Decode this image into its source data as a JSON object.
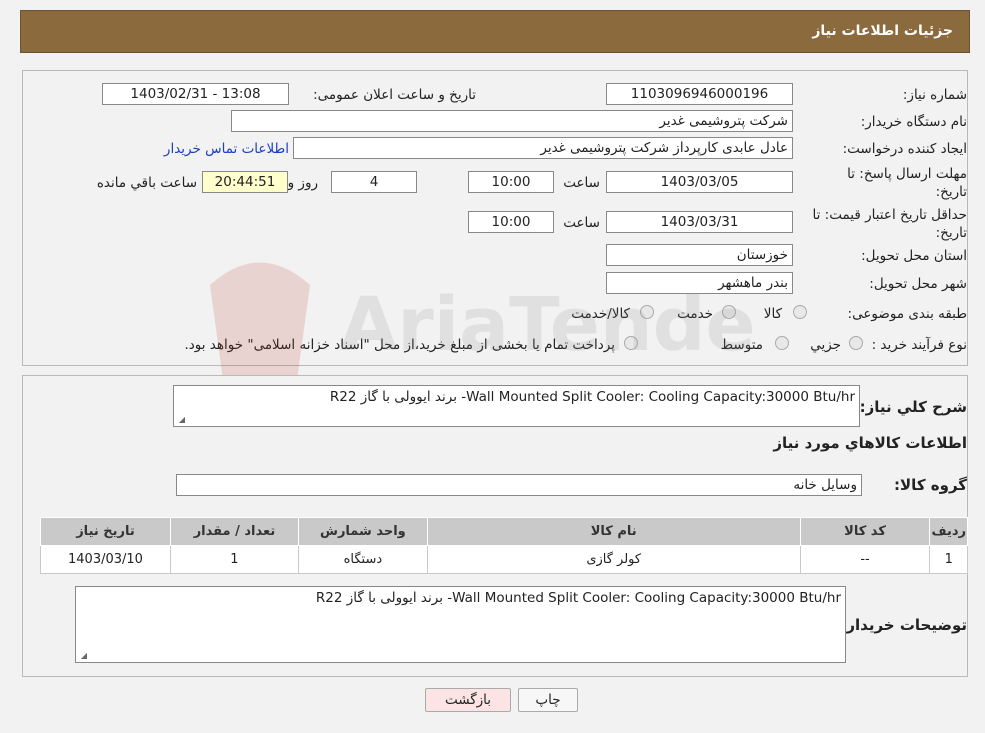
{
  "header": {
    "title": "جزئیات اطلاعات نیاز"
  },
  "form": {
    "need_number_label": "شماره نیاز:",
    "need_number": "1103096946000196",
    "announce_label": "تاریخ و ساعت اعلان عمومی:",
    "announce_value": "1403/02/31 - 13:08",
    "buyer_org_label": "نام دستگاه خریدار:",
    "buyer_org": "شرکت پتروشیمی غدیر",
    "creator_label": "ایجاد کننده درخواست:",
    "creator": "عادل عابدی کارپرداز شرکت پتروشیمی غدیر",
    "contact_link": "اطلاعات تماس خریدار",
    "deadline_label_1": "مهلت ارسال پاسخ: تا",
    "deadline_label_2": "تاریخ:",
    "deadline_date": "1403/03/05",
    "time_label": "ساعت",
    "deadline_time": "10:00",
    "days_value": "4",
    "days_label": "روز و",
    "remaining_time": "20:44:51",
    "remaining_label": "ساعت باقي مانده",
    "validity_label_1": "حداقل تاریخ اعتبار قیمت: تا",
    "validity_label_2": "تاریخ:",
    "validity_date": "1403/03/31",
    "validity_time": "10:00",
    "province_label": "استان محل تحویل:",
    "province": "خوزستان",
    "city_label": "شهر محل تحویل:",
    "city": "بندر ماهشهر",
    "category_label": "طبقه بندی موضوعی:",
    "category_options": [
      "کالا",
      "خدمت",
      "کالا/خدمت"
    ],
    "process_label": "نوع فرآیند خرید :",
    "process_options": [
      "جزيي",
      "متوسط"
    ],
    "process_note": "پرداخت تمام یا بخشی از مبلغ خرید،از محل \"اسناد خزانه اسلامی\" خواهد بود."
  },
  "details": {
    "desc_label": "شرح کلي نياز:",
    "desc_value": "Wall Mounted Split Cooler: Cooling Capacity:30000 Btu/hr- برند ایوولی با گاز R22",
    "goods_info_title": "اطلاعات کالاهاي مورد نياز",
    "goods_group_label": "گروه کالا:",
    "goods_group_value": "وسایل خانه",
    "table": {
      "headers": [
        "رديف",
        "کد کالا",
        "نام کالا",
        "واحد شمارش",
        "تعداد / مقدار",
        "تاریخ نیاز"
      ],
      "rows": [
        [
          "1",
          "--",
          "کولر گازی",
          "دستگاه",
          "1",
          "1403/03/10"
        ]
      ]
    },
    "buyer_notes_label": "توضیحات خریدار:",
    "buyer_notes_value": "Wall Mounted Split Cooler: Cooling Capacity:30000 Btu/hr- برند ایوولی با گاز R22"
  },
  "buttons": {
    "print": "چاپ",
    "back": "بازگشت"
  },
  "watermark": {
    "text": "AriaTender.neT"
  }
}
